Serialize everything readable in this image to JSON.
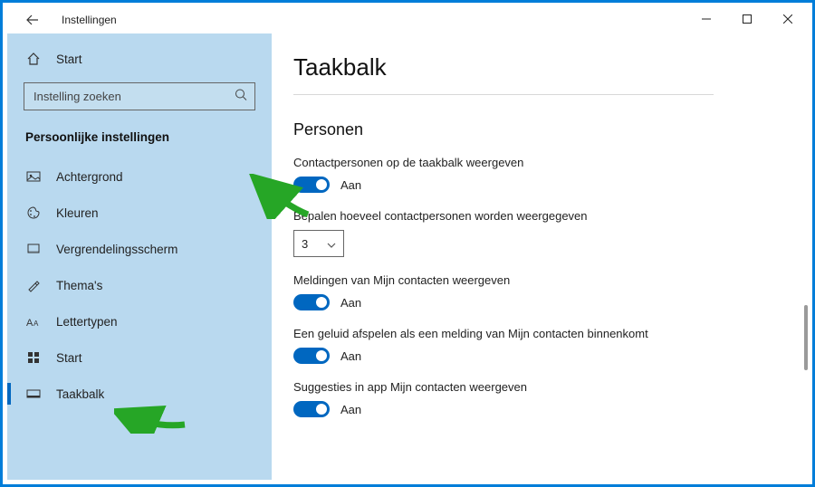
{
  "window": {
    "title": "Instellingen",
    "controls": {
      "minimize": "–",
      "maximize": "□",
      "close": "✕"
    }
  },
  "sidebar": {
    "home_label": "Start",
    "search_placeholder": "Instelling zoeken",
    "category_title": "Persoonlijke instellingen",
    "items": [
      {
        "label": "Achtergrond"
      },
      {
        "label": "Kleuren"
      },
      {
        "label": "Vergrendelingsscherm"
      },
      {
        "label": "Thema's"
      },
      {
        "label": "Lettertypen"
      },
      {
        "label": "Start"
      },
      {
        "label": "Taakbalk"
      }
    ]
  },
  "page": {
    "title": "Taakbalk",
    "section_title": "Personen",
    "toggle_state_on": "Aan",
    "settings": {
      "show_contacts_label": "Contactpersonen op de taakbalk weergeven",
      "count_label": "Bepalen hoeveel contactpersonen worden weergegeven",
      "count_value": "3",
      "notifications_label": "Meldingen van Mijn contacten weergeven",
      "sound_label": "Een geluid afspelen als een melding van Mijn contacten binnenkomt",
      "suggestions_label": "Suggesties in app Mijn contacten weergeven"
    }
  },
  "colors": {
    "accent": "#0067c0",
    "sidebar_bg": "#b9d9ef",
    "arrow": "#26a626"
  }
}
